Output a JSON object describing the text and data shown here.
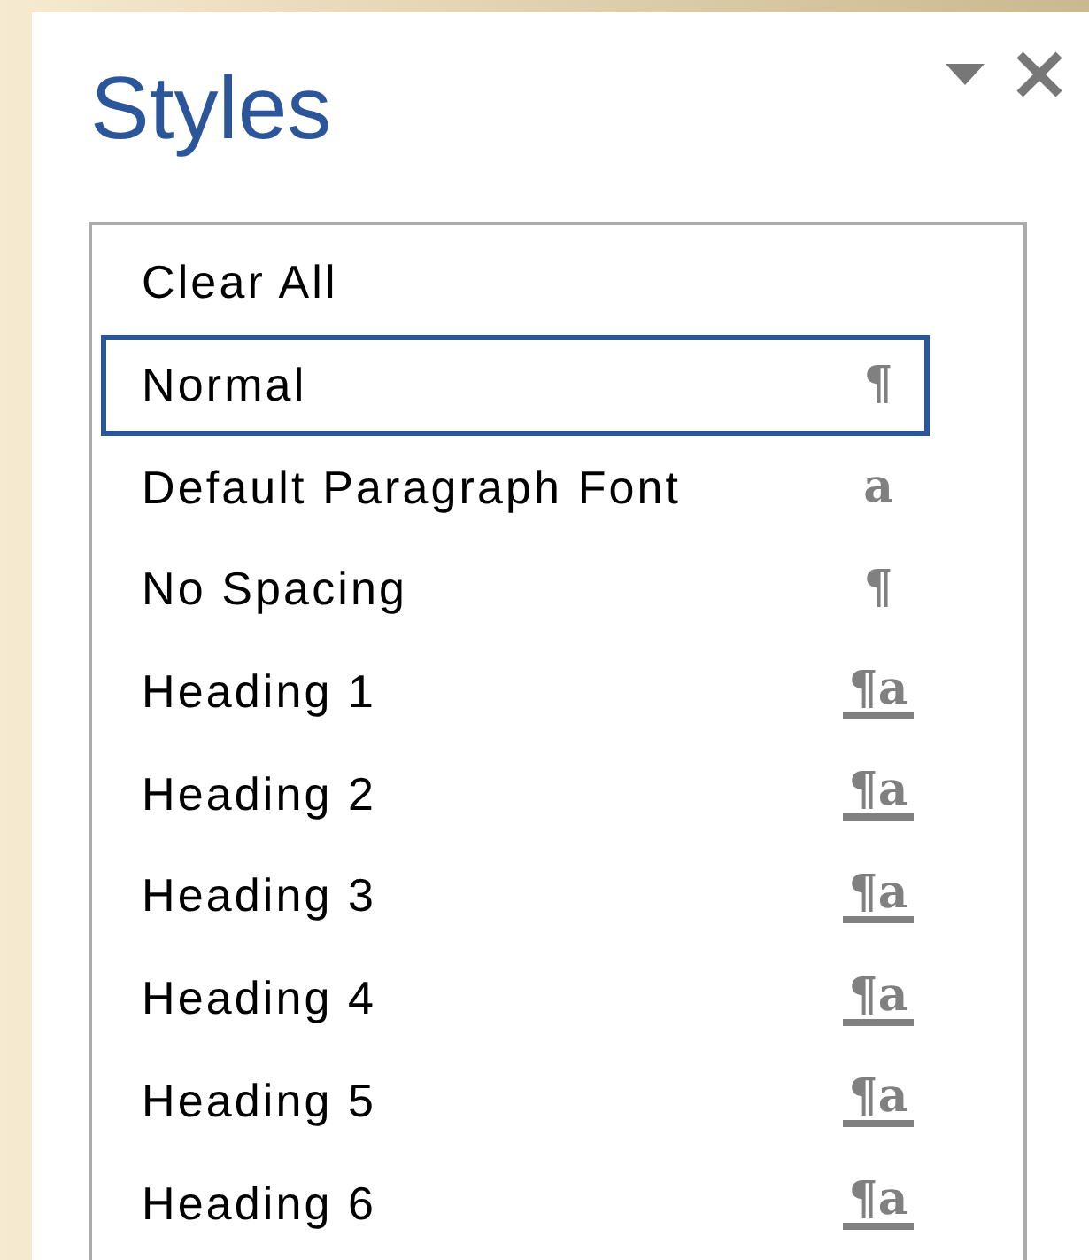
{
  "pane": {
    "title": "Styles"
  },
  "styles": [
    {
      "label": "Clear All",
      "selected": false
    },
    {
      "label": "Normal",
      "kind": "paragraph",
      "glyph": "¶",
      "selected": true
    },
    {
      "label": "Default Paragraph Font",
      "kind": "character",
      "glyph": "a",
      "selected": false
    },
    {
      "label": "No Spacing",
      "kind": "paragraph",
      "glyph": "¶",
      "selected": false
    },
    {
      "label": "Heading 1",
      "kind": "linked",
      "glyph": "¶a",
      "selected": false
    },
    {
      "label": "Heading 2",
      "kind": "linked",
      "glyph": "¶a",
      "selected": false
    },
    {
      "label": "Heading 3",
      "kind": "linked",
      "glyph": "¶a",
      "selected": false
    },
    {
      "label": "Heading 4",
      "kind": "linked",
      "glyph": "¶a",
      "selected": false
    },
    {
      "label": "Heading 5",
      "kind": "linked",
      "glyph": "¶a",
      "selected": false
    },
    {
      "label": "Heading 6",
      "kind": "linked",
      "glyph": "¶a",
      "selected": false
    }
  ]
}
